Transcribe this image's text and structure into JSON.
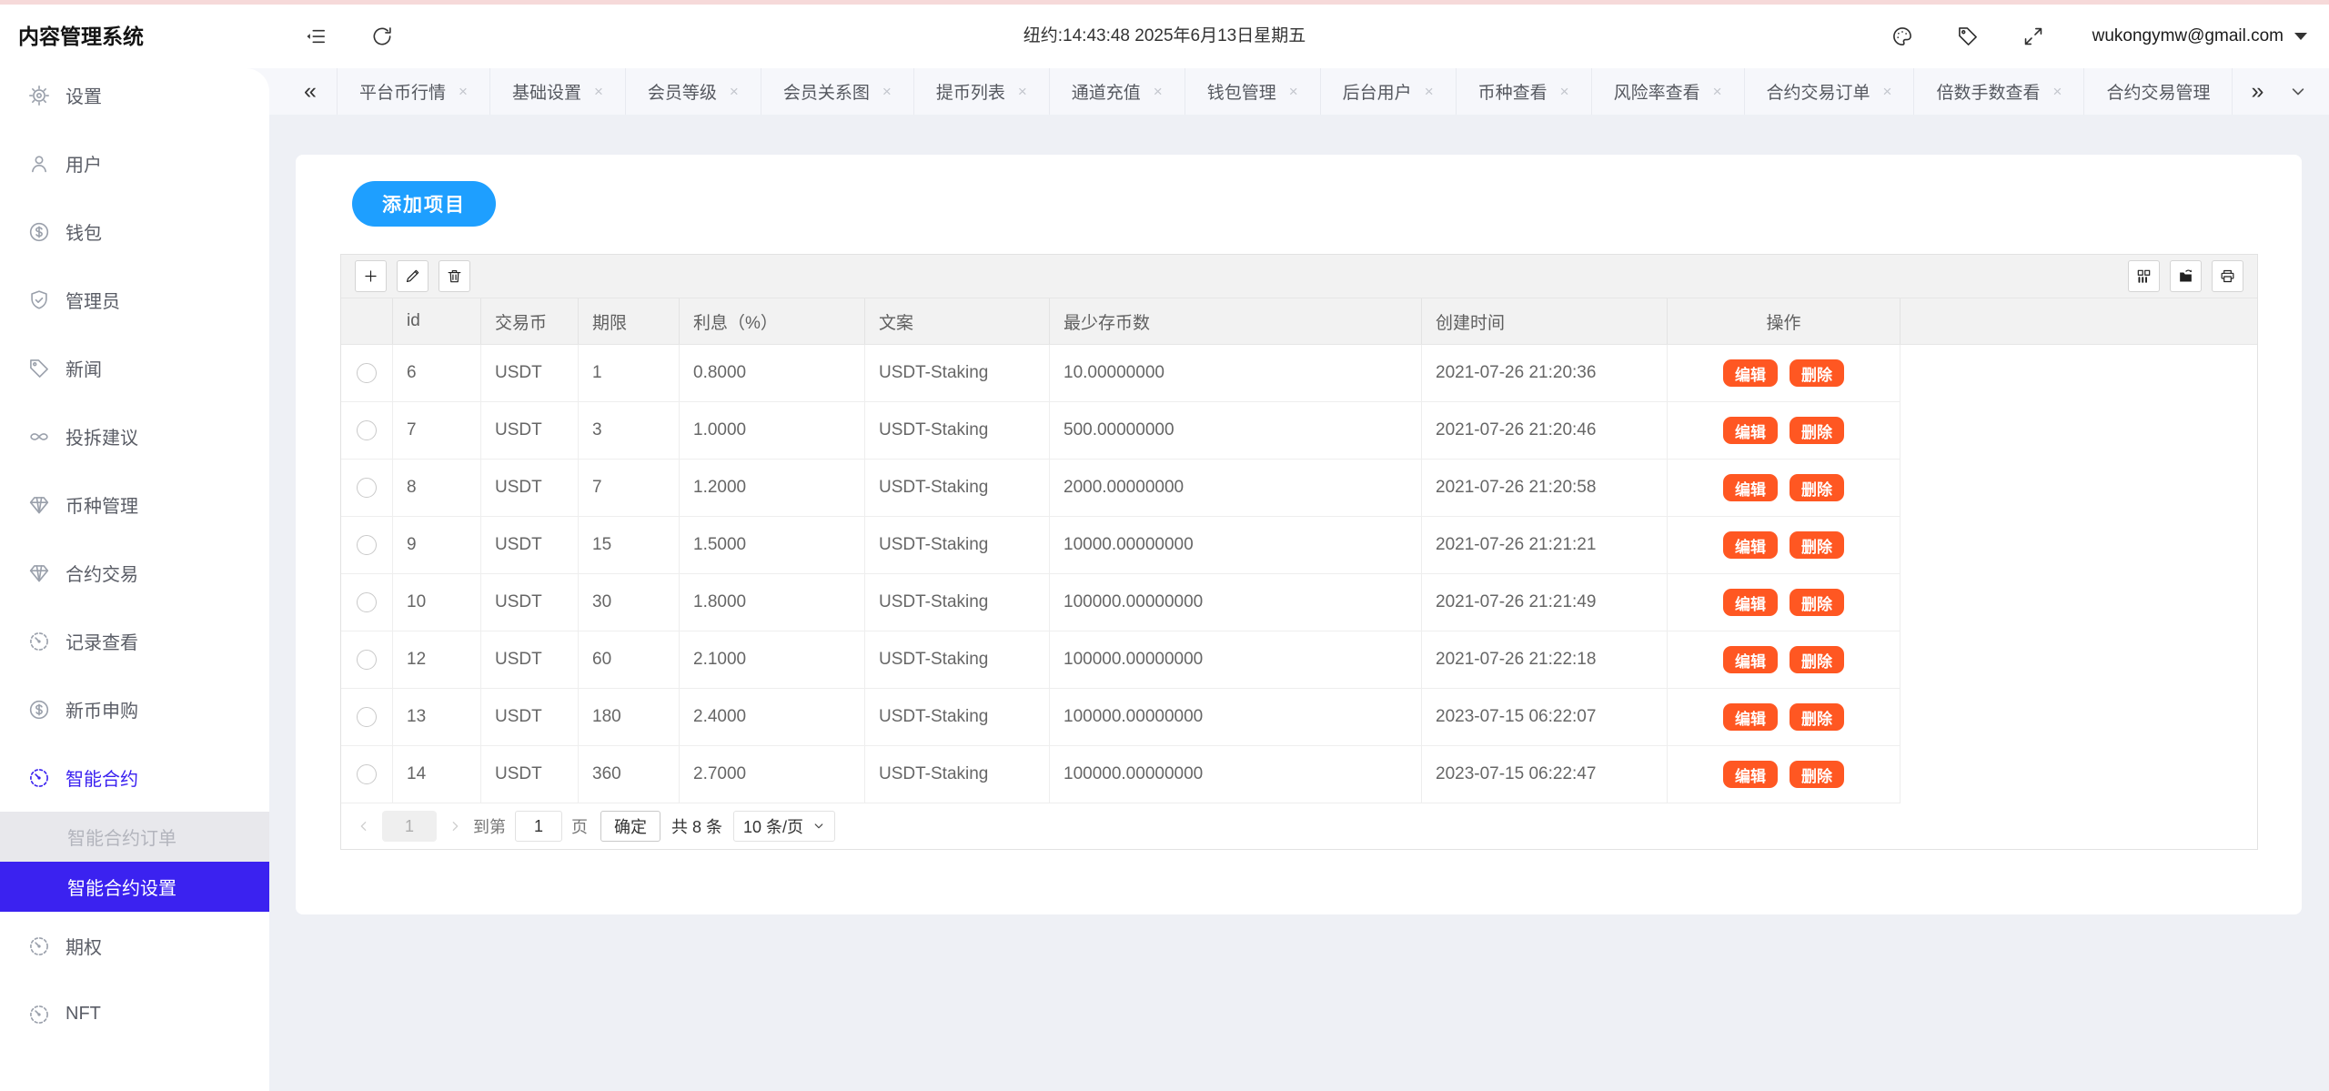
{
  "colors": {
    "top_line": "#f6d9d9",
    "accent_blue": "#1e9fff",
    "accent_violet": "#3b22f0",
    "danger_orange": "#ff5722"
  },
  "header": {
    "app_title": "内容管理系统",
    "clock": "纽约:14:43:48 2025年6月13日星期五",
    "user_email": "wukongymw@gmail.com",
    "left_icons": [
      "menu-collapse",
      "refresh"
    ],
    "right_icons": [
      "palette",
      "tag",
      "fullscreen"
    ]
  },
  "tab_bar": {
    "left_arrow": "«",
    "right_arrow": "»",
    "tabs": [
      {
        "label": "平台币行情",
        "closable": true
      },
      {
        "label": "基础设置",
        "closable": true
      },
      {
        "label": "会员等级",
        "closable": true
      },
      {
        "label": "会员关系图",
        "closable": true
      },
      {
        "label": "提币列表",
        "closable": true
      },
      {
        "label": "通道充值",
        "closable": true
      },
      {
        "label": "钱包管理",
        "closable": true
      },
      {
        "label": "后台用户",
        "closable": true
      },
      {
        "label": "币种查看",
        "closable": true
      },
      {
        "label": "风险率查看",
        "closable": true
      },
      {
        "label": "合约交易订单",
        "closable": true
      },
      {
        "label": "倍数手数查看",
        "closable": true
      },
      {
        "label": "合约交易管理",
        "closable": false
      }
    ]
  },
  "sidebar": {
    "menu": [
      {
        "type": "item",
        "label": "设置",
        "icon": "gear"
      },
      {
        "type": "item",
        "label": "用户",
        "icon": "user"
      },
      {
        "type": "item",
        "label": "钱包",
        "icon": "wallet-dollar"
      },
      {
        "type": "item",
        "label": "管理员",
        "icon": "shield-check"
      },
      {
        "type": "item",
        "label": "新闻",
        "icon": "tag"
      },
      {
        "type": "item",
        "label": "投拆建议",
        "icon": "infinity-link"
      },
      {
        "type": "item",
        "label": "币种管理",
        "icon": "gem"
      },
      {
        "type": "item",
        "label": "合约交易",
        "icon": "gem"
      },
      {
        "type": "item",
        "label": "记录查看",
        "icon": "compass"
      },
      {
        "type": "item",
        "label": "新币申购",
        "icon": "wallet-dollar"
      },
      {
        "type": "item",
        "label": "智能合约",
        "icon": "compass",
        "active": true
      },
      {
        "type": "sub",
        "label": "智能合约订单",
        "state": "muted"
      },
      {
        "type": "sub",
        "label": "智能合约设置",
        "state": "selected"
      },
      {
        "type": "item",
        "label": "期权",
        "icon": "compass"
      },
      {
        "type": "item",
        "label": "NFT",
        "icon": "compass"
      }
    ]
  },
  "content": {
    "add_button_label": "添加项目",
    "toolbar": {
      "left_icons": [
        "plus",
        "edit-pencil",
        "trash"
      ],
      "right_icons": [
        "columns-grid",
        "export",
        "print"
      ]
    },
    "table": {
      "columns": [
        "id",
        "交易币",
        "期限",
        "利息（%）",
        "文案",
        "最少存币数",
        "创建时间",
        "操作"
      ],
      "action_labels": {
        "edit": "编辑",
        "delete": "删除"
      },
      "rows": [
        {
          "id": "6",
          "coin": "USDT",
          "term": "1",
          "rate": "0.8000",
          "text": "USDT-Staking",
          "min_deposit": "10.00000000",
          "created": "2021-07-26 21:20:36"
        },
        {
          "id": "7",
          "coin": "USDT",
          "term": "3",
          "rate": "1.0000",
          "text": "USDT-Staking",
          "min_deposit": "500.00000000",
          "created": "2021-07-26 21:20:46"
        },
        {
          "id": "8",
          "coin": "USDT",
          "term": "7",
          "rate": "1.2000",
          "text": "USDT-Staking",
          "min_deposit": "2000.00000000",
          "created": "2021-07-26 21:20:58"
        },
        {
          "id": "9",
          "coin": "USDT",
          "term": "15",
          "rate": "1.5000",
          "text": "USDT-Staking",
          "min_deposit": "10000.00000000",
          "created": "2021-07-26 21:21:21"
        },
        {
          "id": "10",
          "coin": "USDT",
          "term": "30",
          "rate": "1.8000",
          "text": "USDT-Staking",
          "min_deposit": "100000.00000000",
          "created": "2021-07-26 21:21:49"
        },
        {
          "id": "12",
          "coin": "USDT",
          "term": "60",
          "rate": "2.1000",
          "text": "USDT-Staking",
          "min_deposit": "100000.00000000",
          "created": "2021-07-26 21:22:18"
        },
        {
          "id": "13",
          "coin": "USDT",
          "term": "180",
          "rate": "2.4000",
          "text": "USDT-Staking",
          "min_deposit": "100000.00000000",
          "created": "2023-07-15 06:22:07"
        },
        {
          "id": "14",
          "coin": "USDT",
          "term": "360",
          "rate": "2.7000",
          "text": "USDT-Staking",
          "min_deposit": "100000.00000000",
          "created": "2023-07-15 06:22:47"
        }
      ]
    },
    "pagination": {
      "current_page": "1",
      "goto_prefix": "到第",
      "goto_value": "1",
      "goto_suffix": "页",
      "confirm_label": "确定",
      "total_text": "共 8 条",
      "page_size": "10 条/页"
    }
  }
}
